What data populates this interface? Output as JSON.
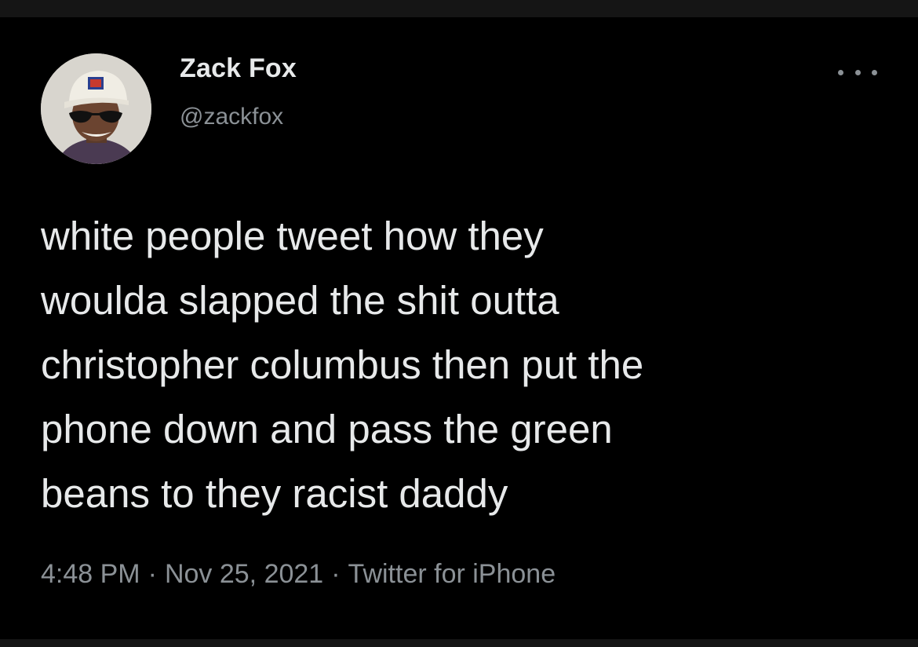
{
  "user": {
    "display_name": "Zack Fox",
    "handle": "@zackfox",
    "avatar_icon": "profile-photo-man-with-cap-and-sunglasses"
  },
  "more_icon": "ellipsis-icon",
  "tweet": {
    "lines": [
      "white people tweet how they",
      "woulda slapped the shit outta",
      "christopher columbus then put the",
      "phone down and pass the green",
      "beans to they racist daddy"
    ]
  },
  "meta": {
    "time": "4:48 PM",
    "separator": "·",
    "date": "Nov 25, 2021",
    "source": "Twitter for iPhone"
  },
  "colors": {
    "background": "#000000",
    "primary_text": "#e7e9ea",
    "secondary_text": "#8b9196",
    "frame": "#151515"
  }
}
